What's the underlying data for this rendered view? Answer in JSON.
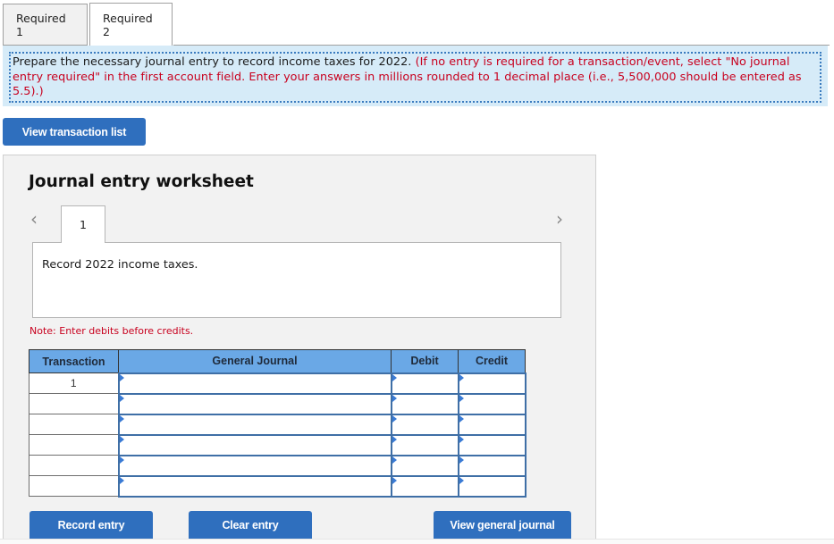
{
  "tabs": [
    {
      "label": "Required 1",
      "active": false
    },
    {
      "label": "Required 2",
      "active": true
    }
  ],
  "instructions": {
    "main": "Prepare the necessary journal entry to record income taxes for 2022.",
    "note": "(If no entry is required for a transaction/event, select \"No journal entry required\" in the first account field. Enter your answers in millions rounded to 1 decimal place (i.e., 5,500,000 should be entered as 5.5).)"
  },
  "buttons": {
    "view_transaction_list": "View transaction list",
    "record_entry": "Record entry",
    "clear_entry": "Clear entry",
    "view_general_journal": "View general journal"
  },
  "worksheet": {
    "title": "Journal entry worksheet",
    "prev_icon": "chevron-left-icon",
    "next_icon": "chevron-right-icon",
    "prev_glyph": "‹",
    "next_glyph": "›",
    "current_entry": "1",
    "entry_description": "Record 2022 income taxes.",
    "note": "Note: Enter debits before credits."
  },
  "journal_table": {
    "headers": {
      "transaction": "Transaction",
      "general_journal": "General Journal",
      "debit": "Debit",
      "credit": "Credit"
    },
    "rows": [
      {
        "transaction": "1",
        "account": "",
        "debit": "",
        "credit": ""
      },
      {
        "transaction": "",
        "account": "",
        "debit": "",
        "credit": ""
      },
      {
        "transaction": "",
        "account": "",
        "debit": "",
        "credit": ""
      },
      {
        "transaction": "",
        "account": "",
        "debit": "",
        "credit": ""
      },
      {
        "transaction": "",
        "account": "",
        "debit": "",
        "credit": ""
      },
      {
        "transaction": "",
        "account": "",
        "debit": "",
        "credit": ""
      }
    ]
  },
  "colors": {
    "accent_button": "#2f6fbe",
    "table_header": "#6aa8e6",
    "instruction_bg": "#d6ebf8",
    "warning_text": "#c8001e"
  }
}
